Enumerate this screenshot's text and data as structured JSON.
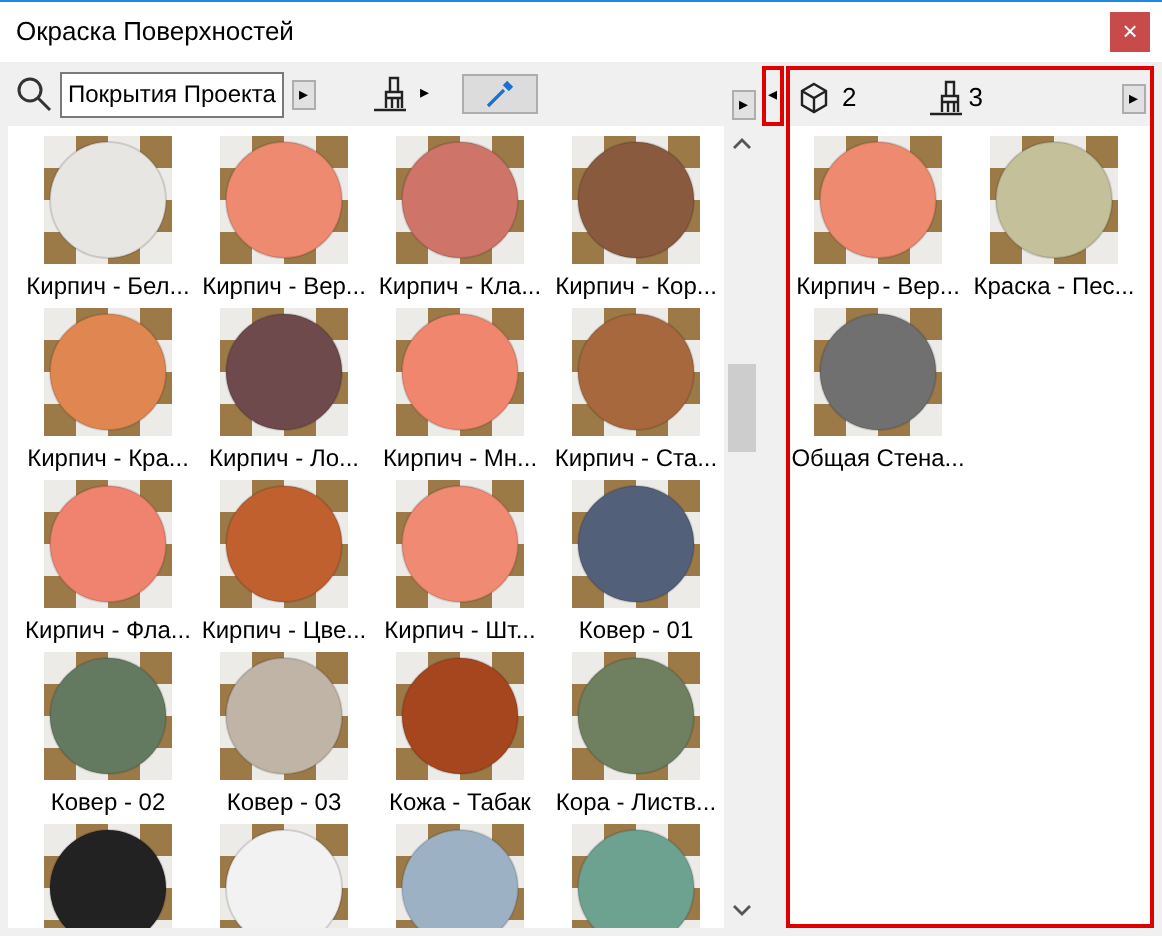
{
  "window": {
    "title": "Окраска Поверхностей",
    "close": "×"
  },
  "toolbar": {
    "search_value": "Покрытия Проекта",
    "arrow": "▸",
    "brush_arrow": "▸",
    "scroll_arrow": "▸",
    "collapse_arrow": "◂"
  },
  "right_toolbar": {
    "objects_count": "2",
    "paint_count": "3",
    "scroll_arrow": "▸"
  },
  "materials": [
    {
      "label": "Кирпич - Бел...",
      "color": "#e8e6e2"
    },
    {
      "label": "Кирпич - Вер...",
      "color": "#ee8a70"
    },
    {
      "label": "Кирпич - Кла...",
      "color": "#cf7468"
    },
    {
      "label": "Кирпич - Кор...",
      "color": "#8a5a3e"
    },
    {
      "label": "Кирпич - Кра...",
      "color": "#e08650"
    },
    {
      "label": "Кирпич - Ло...",
      "color": "#6e4a4c"
    },
    {
      "label": "Кирпич - Мн...",
      "color": "#f0866e"
    },
    {
      "label": "Кирпич - Ста...",
      "color": "#a8683e"
    },
    {
      "label": "Кирпич - Фла...",
      "color": "#f0836f"
    },
    {
      "label": "Кирпич - Цве...",
      "color": "#c0602e"
    },
    {
      "label": "Кирпич - Шт...",
      "color": "#f08a72"
    },
    {
      "label": "Ковер - 01",
      "color": "#52607a"
    },
    {
      "label": "Ковер - 02",
      "color": "#647a60"
    },
    {
      "label": "Ковер - 03",
      "color": "#c0b4a6"
    },
    {
      "label": "Кожа - Табак",
      "color": "#a6461e"
    },
    {
      "label": "Кора - Листв...",
      "color": "#6e8060"
    },
    {
      "color": "#222222"
    },
    {
      "color": "#f2f2f2"
    },
    {
      "color": "#9cb2c4"
    },
    {
      "color": "#6ea290"
    }
  ],
  "used_materials": [
    {
      "label": "Кирпич - Вер...",
      "color": "#ee8a70"
    },
    {
      "label": "Краска - Пес...",
      "color": "#c4c09a"
    },
    {
      "label": "Общая Стена...",
      "color": "#707070"
    }
  ]
}
